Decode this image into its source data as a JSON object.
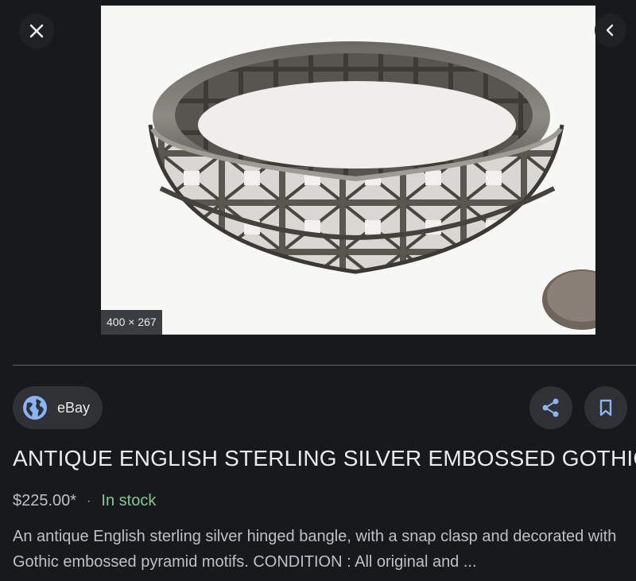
{
  "image": {
    "dimensions": "400 × 267"
  },
  "source": {
    "name": "eBay"
  },
  "result": {
    "title": "ANTIQUE ENGLISH STERLING SILVER EMBOSSED GOTHIC",
    "price": "$225.00*",
    "separator": "·",
    "availability": "In stock",
    "description_line1": "An antique English sterling silver hinged bangle, with a snap clasp and decorated with",
    "description_line2": "Gothic embossed pyramid motifs. CONDITION : All original and ..."
  },
  "colors": {
    "background": "#18191d",
    "accent_blue": "#8ab4f8",
    "stock_green": "#81c995"
  },
  "icons": {
    "close": "close-icon",
    "previous": "chevron-left-icon",
    "source": "globe-icon",
    "share": "share-icon",
    "save": "bookmark-icon"
  }
}
